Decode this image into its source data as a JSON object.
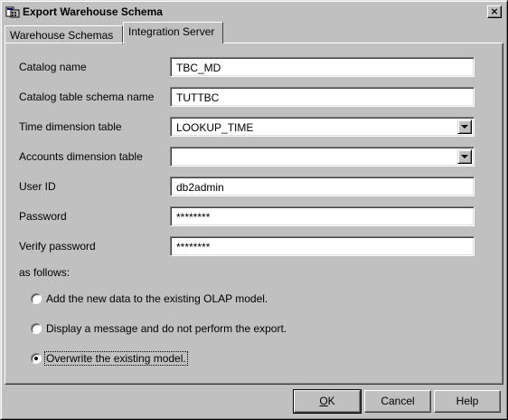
{
  "window": {
    "title": "Export Warehouse Schema",
    "close_glyph": "×"
  },
  "tabs": [
    {
      "label": "Warehouse Schemas",
      "active": false
    },
    {
      "label": "Integration Server",
      "active": true
    }
  ],
  "form": {
    "catalog_name": {
      "label": "Catalog name",
      "value": "TBC_MD"
    },
    "catalog_schema": {
      "label": "Catalog table schema name",
      "value": "TUTTBC"
    },
    "time_dimension": {
      "label": "Time dimension table",
      "value": "LOOKUP_TIME"
    },
    "accounts_dimension": {
      "label": "Accounts dimension table",
      "value": ""
    },
    "user_id": {
      "label": "User ID",
      "value": "db2admin"
    },
    "password": {
      "label": "Password",
      "value": "********"
    },
    "verify_password": {
      "label": "Verify password",
      "value": "********"
    }
  },
  "options_heading": "as follows:",
  "options": [
    {
      "label": "Add the new data to the existing OLAP model.",
      "checked": false
    },
    {
      "label": "Display a message and do not perform the export.",
      "checked": false
    },
    {
      "label": "Overwrite the existing model.",
      "checked": true
    }
  ],
  "buttons": {
    "ok_mnemonic": "O",
    "ok_rest": "K",
    "cancel": "Cancel",
    "help": "Help"
  },
  "icons": {
    "title": "window-app-icon",
    "close": "close-icon",
    "combo": "chevron-down-icon"
  }
}
